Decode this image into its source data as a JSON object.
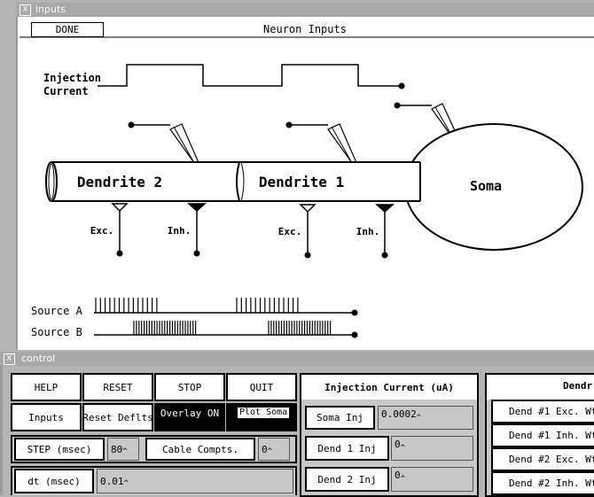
{
  "inputs_window": {
    "title": "inputs",
    "done_label": "DONE",
    "heading": "Neuron Inputs",
    "injection_label_line1": "Injection",
    "injection_label_line2": "Current",
    "dendrite2_label": "Dendrite 2",
    "dendrite1_label": "Dendrite 1",
    "soma_label": "Soma",
    "exc_label_d2": "Exc.",
    "inh_label_d2": "Inh.",
    "exc_label_d1": "Exc.",
    "inh_label_d1": "Inh.",
    "source_a_label": "Source A",
    "source_b_label": "Source B"
  },
  "control_window": {
    "title": "control",
    "buttons": {
      "help": "HELP",
      "reset": "RESET",
      "stop": "STOP",
      "quit": "QUIT",
      "inputs": "Inputs",
      "reset_defaults": "Reset Deflts",
      "overlay": "Overlay ON",
      "plot_soma": "Plot Soma"
    },
    "step": {
      "label": "STEP (msec)",
      "value": "80"
    },
    "cable": {
      "label": "Cable Compts.",
      "value": "0"
    },
    "dt": {
      "label": "dt (msec)",
      "value": "0.01"
    },
    "injection_panel": {
      "title": "Injection Current (uA)",
      "soma_inj": {
        "label": "Soma Inj",
        "value": "0.0002"
      },
      "dend1_inj": {
        "label": "Dend 1 Inj",
        "value": "0"
      },
      "dend2_inj": {
        "label": "Dend 2 Inj",
        "value": "0"
      }
    },
    "dend_panel": {
      "title": "Dendr",
      "items": [
        "Dend #1 Exc. Wt.",
        "Dend #1 Inh. Wt.",
        "Dend #2 Exc. Wt.",
        "Dend #2 Inh. Wt."
      ]
    }
  }
}
